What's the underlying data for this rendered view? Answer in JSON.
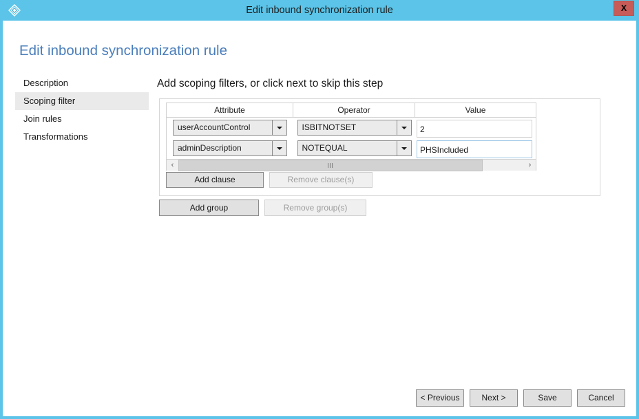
{
  "window": {
    "title": "Edit inbound synchronization rule",
    "app_icon": "diamond-icon",
    "close_label": "X",
    "titlebar_color": "#5bc4e8",
    "close_button_color": "#c75b57"
  },
  "page": {
    "heading": "Edit inbound synchronization rule",
    "heading_color": "#4a7ebb"
  },
  "sidebar": {
    "items": [
      {
        "label": "Description",
        "selected": false
      },
      {
        "label": "Scoping filter",
        "selected": true
      },
      {
        "label": "Join rules",
        "selected": false
      },
      {
        "label": "Transformations",
        "selected": false
      }
    ]
  },
  "main": {
    "instruction": "Add scoping filters, or click next to skip this step",
    "grid": {
      "columns": [
        "Attribute",
        "Operator",
        "Value"
      ],
      "rows": [
        {
          "attribute": "userAccountControl",
          "operator": "ISBITNOTSET",
          "value": "2",
          "value_focused": false
        },
        {
          "attribute": "adminDescription",
          "operator": "NOTEQUAL",
          "value": "PHSIncluded",
          "value_focused": true
        }
      ],
      "scrollbar": {
        "left_arrow": "‹",
        "right_arrow": "›",
        "orientation": "horizontal"
      }
    },
    "clause_buttons": {
      "add": {
        "label": "Add clause",
        "disabled": false
      },
      "remove": {
        "label": "Remove clause(s)",
        "disabled": true
      }
    },
    "group_buttons": {
      "add": {
        "label": "Add group",
        "disabled": false
      },
      "remove": {
        "label": "Remove group(s)",
        "disabled": true
      }
    }
  },
  "footer": {
    "buttons": [
      {
        "label": "< Previous",
        "disabled": false
      },
      {
        "label": "Next >",
        "disabled": false
      },
      {
        "label": "Save",
        "disabled": false
      },
      {
        "label": "Cancel",
        "disabled": false
      }
    ]
  }
}
